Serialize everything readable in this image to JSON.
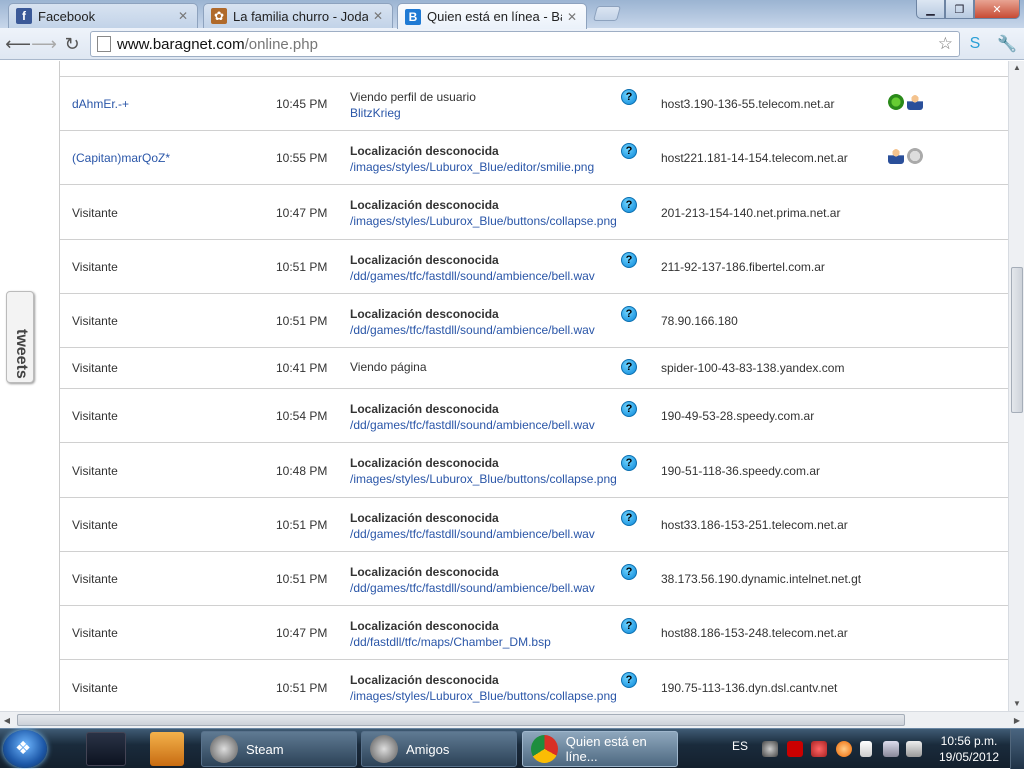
{
  "browser": {
    "tabs": [
      {
        "title": "Facebook",
        "favicon": "facebook-icon",
        "active": false
      },
      {
        "title": "La familia churro - Jodas tel",
        "favicon": "churro-icon",
        "active": false
      },
      {
        "title": "Quien está en línea - Baragn",
        "favicon": "baragnet-icon",
        "active": true
      }
    ],
    "url_host": "www.baragnet.com",
    "url_path": "/online.php"
  },
  "sidebar": {
    "tweets_label": "tweets"
  },
  "online_users": [
    {
      "user": "dAhmEr.-+",
      "user_link": true,
      "time": "10:45 PM",
      "location_title": "Viendo perfil de usuario",
      "location_title_bold": false,
      "location_detail": "BlitzKrieg",
      "host": "host3.190-136-55.telecom.net.ar",
      "icons": [
        "clover-icon",
        "user-icon"
      ]
    },
    {
      "user": "(Capitan)marQoZ*",
      "user_link": true,
      "time": "10:55 PM",
      "location_title": "Localización desconocida",
      "location_title_bold": true,
      "location_detail": "/images/styles/Luburox_Blue/editor/smilie.png",
      "host": "host221.181-14-154.telecom.net.ar",
      "icons": [
        "user-icon",
        "offline-icon"
      ]
    },
    {
      "user": "Visitante",
      "user_link": false,
      "time": "10:47 PM",
      "location_title": "Localización desconocida",
      "location_title_bold": true,
      "location_detail": "/images/styles/Luburox_Blue/buttons/collapse.png",
      "host": "201-213-154-140.net.prima.net.ar",
      "icons": []
    },
    {
      "user": "Visitante",
      "user_link": false,
      "time": "10:51 PM",
      "location_title": "Localización desconocida",
      "location_title_bold": true,
      "location_detail": "/dd/games/tfc/fastdll/sound/ambience/bell.wav",
      "host": "211-92-137-186.fibertel.com.ar",
      "icons": []
    },
    {
      "user": "Visitante",
      "user_link": false,
      "time": "10:51 PM",
      "location_title": "Localización desconocida",
      "location_title_bold": true,
      "location_detail": "/dd/games/tfc/fastdll/sound/ambience/bell.wav",
      "host": "78.90.166.180",
      "icons": []
    },
    {
      "user": "Visitante",
      "user_link": false,
      "time": "10:41 PM",
      "location_title": "Viendo página",
      "location_title_bold": false,
      "location_detail": "",
      "host": "spider-100-43-83-138.yandex.com",
      "icons": []
    },
    {
      "user": "Visitante",
      "user_link": false,
      "time": "10:54 PM",
      "location_title": "Localización desconocida",
      "location_title_bold": true,
      "location_detail": "/dd/games/tfc/fastdll/sound/ambience/bell.wav",
      "host": "190-49-53-28.speedy.com.ar",
      "icons": []
    },
    {
      "user": "Visitante",
      "user_link": false,
      "time": "10:48 PM",
      "location_title": "Localización desconocida",
      "location_title_bold": true,
      "location_detail": "/images/styles/Luburox_Blue/buttons/collapse.png",
      "host": "190-51-118-36.speedy.com.ar",
      "icons": []
    },
    {
      "user": "Visitante",
      "user_link": false,
      "time": "10:51 PM",
      "location_title": "Localización desconocida",
      "location_title_bold": true,
      "location_detail": "/dd/games/tfc/fastdll/sound/ambience/bell.wav",
      "host": "host33.186-153-251.telecom.net.ar",
      "icons": []
    },
    {
      "user": "Visitante",
      "user_link": false,
      "time": "10:51 PM",
      "location_title": "Localización desconocida",
      "location_title_bold": true,
      "location_detail": "/dd/games/tfc/fastdll/sound/ambience/bell.wav",
      "host": "38.173.56.190.dynamic.intelnet.net.gt",
      "icons": []
    },
    {
      "user": "Visitante",
      "user_link": false,
      "time": "10:47 PM",
      "location_title": "Localización desconocida",
      "location_title_bold": true,
      "location_detail": "/dd/fastdll/tfc/maps/Chamber_DM.bsp",
      "host": "host88.186-153-248.telecom.net.ar",
      "icons": []
    },
    {
      "user": "Visitante",
      "user_link": false,
      "time": "10:51 PM",
      "location_title": "Localización desconocida",
      "location_title_bold": true,
      "location_detail": "/images/styles/Luburox_Blue/buttons/collapse.png",
      "host": "190.75-113-136.dyn.dsl.cantv.net",
      "icons": []
    }
  ],
  "help_glyph": "?",
  "taskbar": {
    "tasks": [
      {
        "label": "Steam",
        "icon": "steam-icon",
        "active": false
      },
      {
        "label": "Amigos",
        "icon": "steam-icon",
        "active": false
      },
      {
        "label": "Quien está en líne...",
        "icon": "chrome-icon",
        "active": true
      }
    ],
    "language": "ES",
    "clock_time": "10:56 p.m.",
    "clock_date": "19/05/2012"
  }
}
